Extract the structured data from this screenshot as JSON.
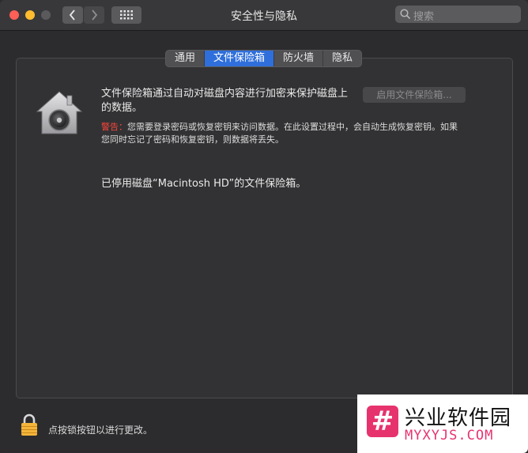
{
  "window": {
    "title": "安全性与隐私"
  },
  "search": {
    "placeholder": "搜索"
  },
  "tabs": [
    {
      "label": "通用"
    },
    {
      "label": "文件保险箱"
    },
    {
      "label": "防火墙"
    },
    {
      "label": "隐私"
    }
  ],
  "filevault": {
    "description": "文件保险箱通过自动对磁盘内容进行加密来保护磁盘上的数据。",
    "enable_button": "启用文件保险箱...",
    "warning_label": "警告：",
    "warning_text": "您需要登录密码或恢复密钥来访问数据。在此设置过程中，会自动生成恢复密钥。如果您同时忘记了密码和恢复密钥，则数据将丢失。",
    "status": "已停用磁盘“Macintosh HD”的文件保险箱。"
  },
  "footer": {
    "lock_text": "点按锁按钮以进行更改。"
  },
  "watermark": {
    "logo_glyph": "#",
    "title": "兴业软件园",
    "subtitle": "MYXYJS.COM"
  },
  "colors": {
    "accent": "#2f6fdc",
    "warning": "#ff453a",
    "close": "#ff5f57",
    "minimize": "#febc2e",
    "lock": "#f5b53a",
    "watermark_pink": "#e6336e"
  },
  "icons": {
    "house": "filevault-house-icon",
    "lock": "lock-icon",
    "search": "search-icon"
  }
}
